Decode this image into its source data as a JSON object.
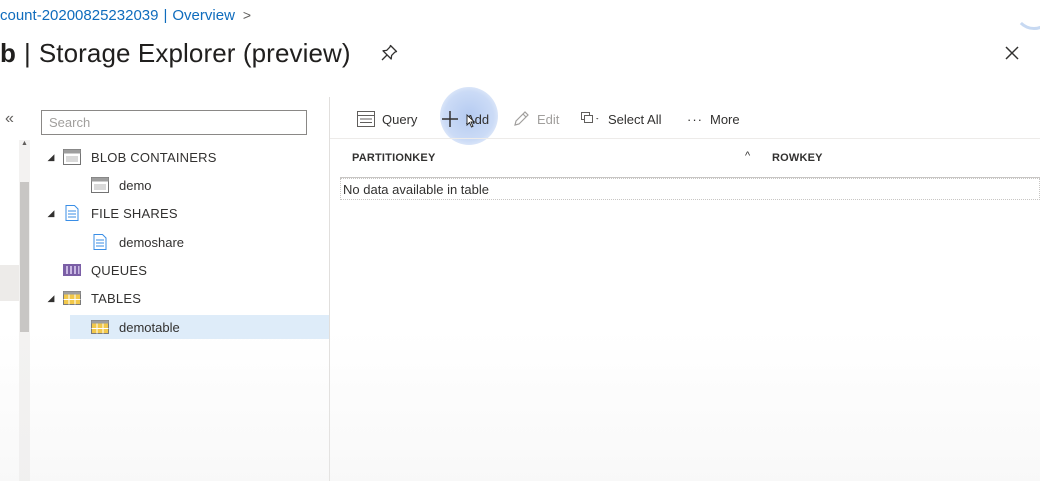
{
  "breadcrumb": {
    "account_label": "count-20200825232039",
    "separator": "|",
    "overview_label": "Overview",
    "chevron": ">"
  },
  "header": {
    "title_prefix": "b",
    "title_separator": "|",
    "title": "Storage Explorer (preview)",
    "pin_icon": "pin-icon",
    "close_icon": "close-icon"
  },
  "sidebar": {
    "collapse_icon": "«",
    "search_placeholder": "Search",
    "search_value": "",
    "tree": [
      {
        "label": "BLOB CONTAINERS",
        "expanded": true,
        "icon": "blob-container-icon"
      },
      {
        "label": "demo",
        "icon": "container-icon"
      },
      {
        "label": "FILE SHARES",
        "expanded": true,
        "icon": "file-share-icon"
      },
      {
        "label": "demoshare",
        "icon": "share-icon"
      },
      {
        "label": "QUEUES",
        "icon": "queue-icon"
      },
      {
        "label": "TABLES",
        "expanded": true,
        "icon": "tables-icon"
      },
      {
        "label": "demotable",
        "icon": "table-icon",
        "selected": true
      }
    ]
  },
  "toolbar": {
    "query_label": "Query",
    "add_label": "Add",
    "edit_label": "Edit",
    "select_all_label": "Select All",
    "more_label": "More"
  },
  "table": {
    "columns": [
      "PARTITIONKEY",
      "ROWKEY"
    ],
    "empty_message": "No data available in table"
  },
  "colors": {
    "link": "#0f6cbd",
    "selected_row": "#deecf9",
    "add_halo": "#8fb0ea",
    "disabled_text": "#a19f9d"
  }
}
